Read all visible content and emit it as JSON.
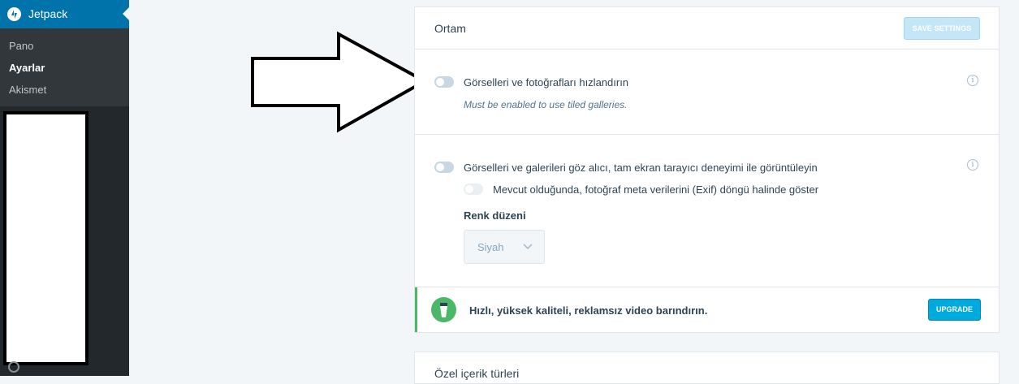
{
  "sidebar": {
    "title": "Jetpack",
    "items": [
      {
        "label": "Pano"
      },
      {
        "label": "Ayarlar"
      },
      {
        "label": "Akismet"
      }
    ]
  },
  "media_card": {
    "title": "Ortam",
    "save_label": "SAVE SETTINGS",
    "photon": {
      "label": "Görselleri ve fotoğrafları hızlandırın",
      "hint": "Must be enabled to use tiled galleries.",
      "enabled": false
    },
    "carousel": {
      "label": "Görselleri ve galerileri göz alıcı, tam ekran tarayıcı deneyimi ile görüntüleyin",
      "enabled": false,
      "exif_label": "Mevcut olduğunda, fotoğraf meta verilerini (Exif) döngü halinde göster",
      "color_scheme_label": "Renk düzeni",
      "color_scheme_value": "Siyah"
    },
    "upsell": {
      "text": "Hızlı, yüksek kaliteli, reklamsız video barındırın.",
      "button": "UPGRADE"
    }
  },
  "next_card": {
    "title": "Özel içerik türleri"
  },
  "colors": {
    "accent": "#00aadc",
    "sidebar": "#23282d",
    "sidebar_header": "#0073aa",
    "success": "#4ab866"
  },
  "icons": [
    "jetpack-logo-icon",
    "info-icon",
    "chevron-down-icon",
    "video-icon"
  ]
}
